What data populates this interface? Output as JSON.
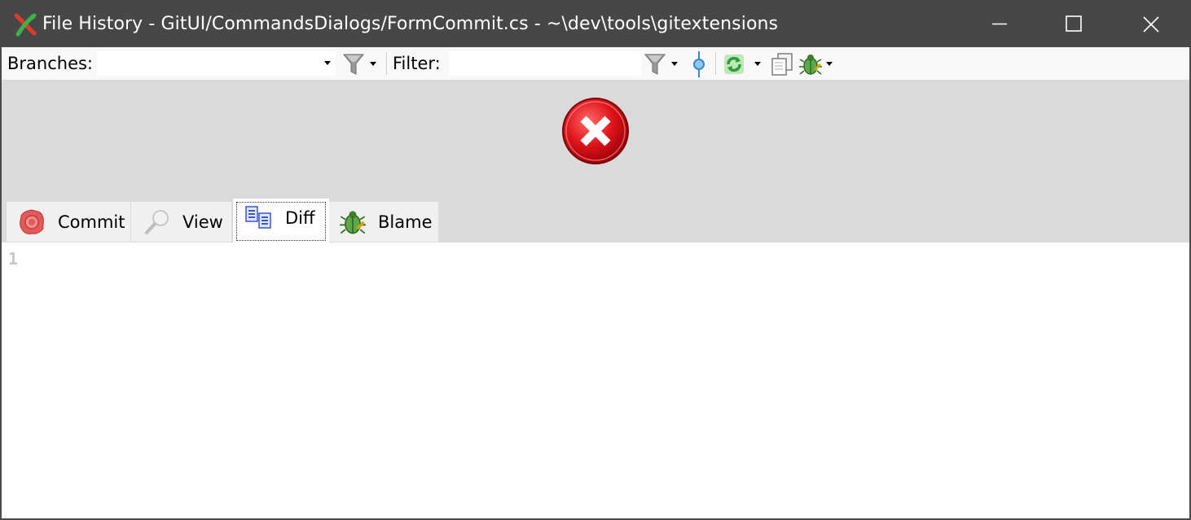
{
  "window": {
    "title": "File History - GitUI/CommandsDialogs/FormCommit.cs - ~\\dev\\tools\\gitextensions",
    "controls": [
      "minimize-icon",
      "maximize-icon",
      "close-icon"
    ]
  },
  "toolbar": {
    "branches_label": "Branches:",
    "branches_value": "",
    "filter_label": "Filter:",
    "filter_value": "",
    "icons": [
      "filter-icon",
      "filter-icon",
      "commit-node-icon",
      "refresh-icon",
      "copy-icon",
      "bug-icon"
    ]
  },
  "error": {
    "icon": "error-icon",
    "color": "#e0151b"
  },
  "tabs": [
    {
      "label": "Commit",
      "icon": "commit-seal-icon",
      "selected": false
    },
    {
      "label": "View",
      "icon": "magnifier-icon",
      "selected": false
    },
    {
      "label": "Diff",
      "icon": "diff-icon",
      "selected": true
    },
    {
      "label": "Blame",
      "icon": "bug-icon",
      "selected": false
    }
  ],
  "editor": {
    "line_numbers": [
      "1"
    ],
    "content": ""
  }
}
